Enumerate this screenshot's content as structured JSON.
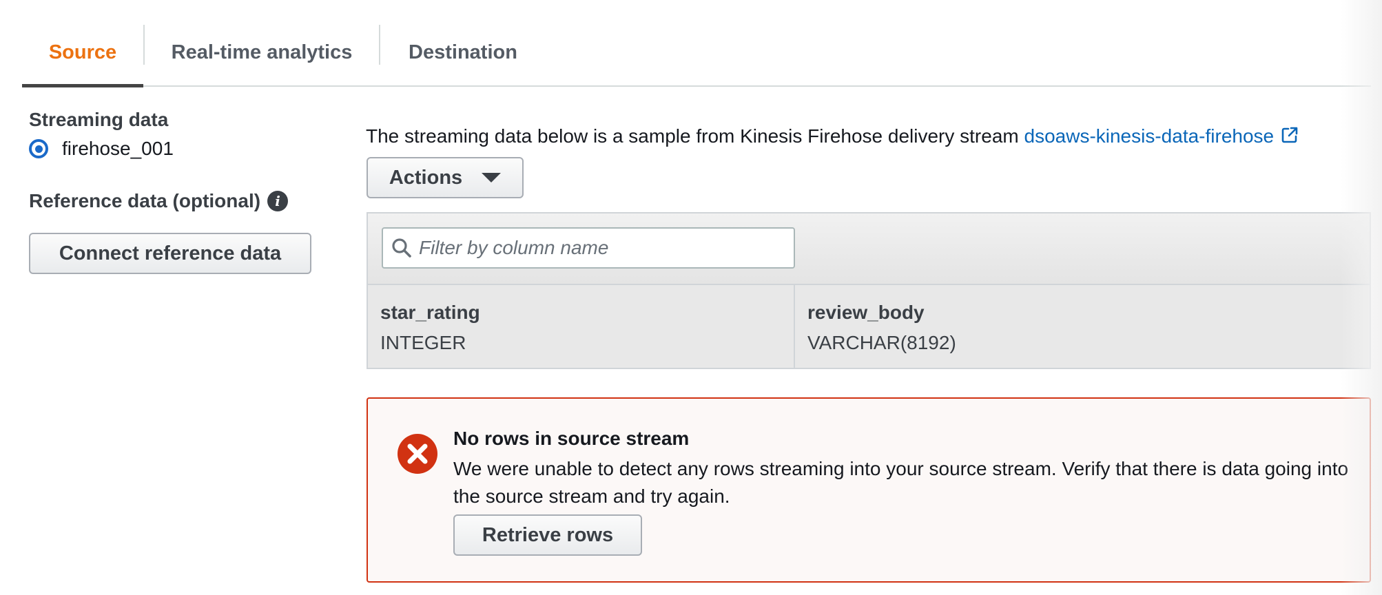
{
  "tabs": [
    {
      "label": "Source",
      "active": true
    },
    {
      "label": "Real-time analytics",
      "active": false
    },
    {
      "label": "Destination",
      "active": false
    }
  ],
  "left_panel": {
    "streaming_data_label": "Streaming data",
    "stream_option": "firehose_001",
    "reference_data_label": "Reference data (optional)",
    "connect_button": "Connect reference data"
  },
  "main": {
    "intro_text": "The streaming data below is a sample from Kinesis Firehose delivery stream ",
    "stream_link": "dsoaws-kinesis-data-firehose",
    "actions_button": "Actions",
    "filter_placeholder": "Filter by column name",
    "columns": [
      {
        "name": "star_rating",
        "type": "INTEGER"
      },
      {
        "name": "review_body",
        "type": "VARCHAR(8192)"
      }
    ]
  },
  "alert": {
    "title": "No rows in source stream",
    "message": "We were unable to detect any rows streaming into your source stream. Verify that there is data going into the source stream and try again.",
    "button": "Retrieve rows"
  },
  "colors": {
    "accent": "#ec7211",
    "link": "#0a66b8",
    "error": "#d13212",
    "radio": "#1b6ac9"
  }
}
